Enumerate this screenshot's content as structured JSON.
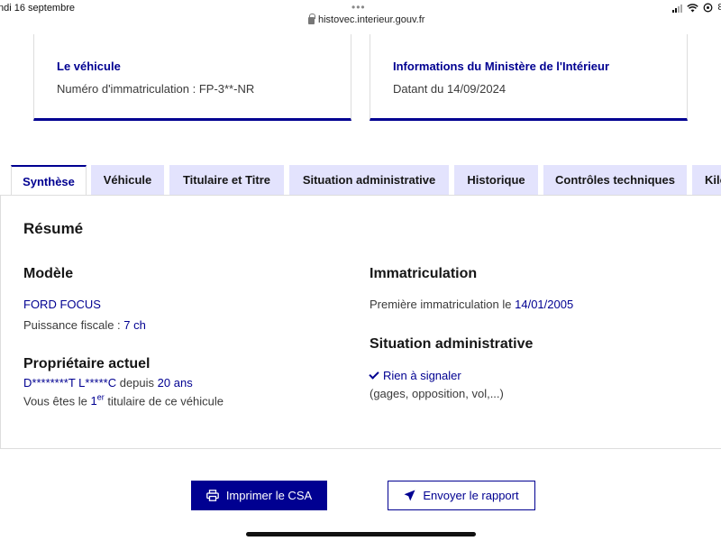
{
  "status": {
    "time": "ndi 16 septembre",
    "url": "histovec.interieur.gouv.fr",
    "battery": "8"
  },
  "cards": {
    "vehicle": {
      "title": "Le véhicule",
      "label": "Numéro d'immatriculation :",
      "plate": "FP-3**-NR"
    },
    "ministry": {
      "title": "Informations du Ministère de l'Intérieur",
      "date_label": "Datant du",
      "date": "14/09/2024"
    }
  },
  "tabs": [
    {
      "label": "Synthèse",
      "active": true
    },
    {
      "label": "Véhicule"
    },
    {
      "label": "Titulaire et Titre"
    },
    {
      "label": "Situation administrative"
    },
    {
      "label": "Historique"
    },
    {
      "label": "Contrôles techniques"
    },
    {
      "label": "Kilo"
    }
  ],
  "summary": {
    "title": "Résumé",
    "model": {
      "heading": "Modèle",
      "name": "FORD FOCUS",
      "power_label": "Puissance fiscale :",
      "power_value": "7 ch"
    },
    "owner": {
      "heading": "Propriétaire actuel",
      "name": "D********T L*****C",
      "since_label": "depuis",
      "since_value": "20 ans",
      "rank_prefix": "Vous êtes le",
      "rank_num": "1",
      "rank_sup": "er",
      "rank_suffix": "titulaire de ce véhicule"
    },
    "registration": {
      "heading": "Immatriculation",
      "first_label": "Première immatriculation le",
      "first_date": "14/01/2005"
    },
    "admin": {
      "heading": "Situation administrative",
      "status": "Rien à signaler",
      "detail": "(gages, opposition, vol,...)"
    }
  },
  "actions": {
    "print": "Imprimer le CSA",
    "send": "Envoyer le rapport"
  }
}
